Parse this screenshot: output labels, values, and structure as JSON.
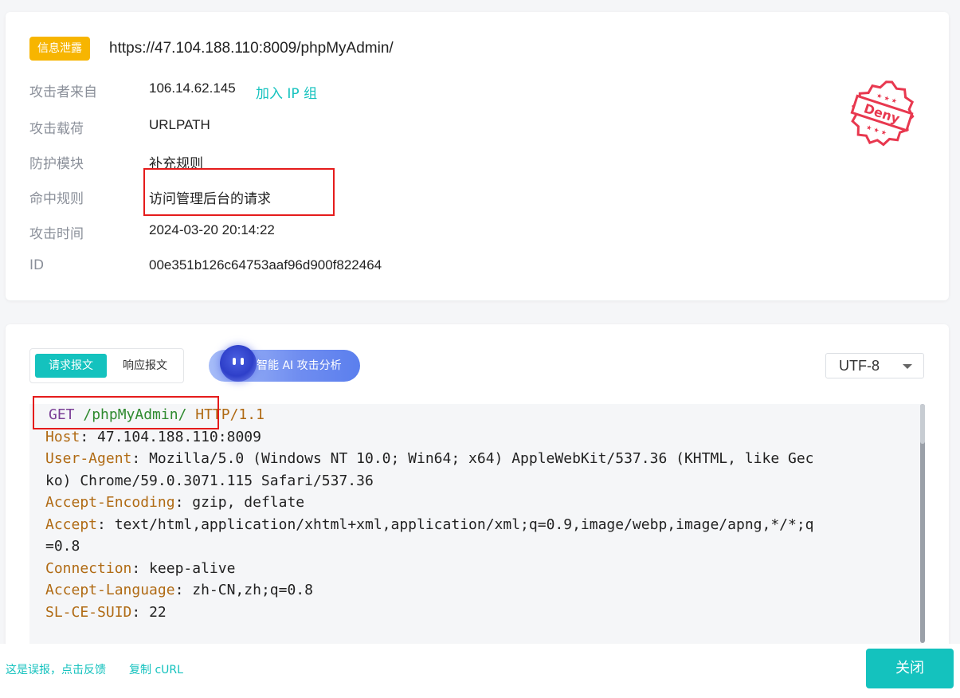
{
  "event": {
    "tag": "信息泄露",
    "url": "https://47.104.188.110:8009/phpMyAdmin/",
    "rows": [
      {
        "label": "攻击者来自",
        "value": "106.14.62.145"
      },
      {
        "label": "攻击载荷",
        "value": "URLPATH"
      },
      {
        "label": "防护模块",
        "value": "补充规则"
      },
      {
        "label": "命中规则",
        "value": "访问管理后台的请求"
      },
      {
        "label": "攻击时间",
        "value": "2024-03-20 20:14:22"
      },
      {
        "label": "ID",
        "value": "00e351b126c64753aaf96d900f822464"
      }
    ],
    "add_ip_group": "加入 IP 组",
    "stamp_text": "Deny"
  },
  "request": {
    "tabs": [
      "请求报文",
      "响应报文"
    ],
    "ai_button": "智能 AI 攻击分析",
    "encoding": "UTF-8",
    "request_line": {
      "method": "GET",
      "path": "/phpMyAdmin/",
      "protocol": "HTTP/1.1"
    },
    "headers": [
      {
        "name": "Host",
        "value": "47.104.188.110:8009"
      },
      {
        "name": "User-Agent",
        "value": "Mozilla/5.0 (Windows NT 10.0; Win64; x64) AppleWebKit/537.36 (KHTML, like Gec",
        "cont": "ko) Chrome/59.0.3071.115 Safari/537.36"
      },
      {
        "name": "Accept-Encoding",
        "value": "gzip, deflate"
      },
      {
        "name": "Accept",
        "value": "text/html,application/xhtml+xml,application/xml;q=0.9,image/webp,image/apng,*/*;q",
        "cont": "=0.8"
      },
      {
        "name": "Connection",
        "value": "keep-alive"
      },
      {
        "name": "Accept-Language",
        "value": "zh-CN,zh;q=0.8"
      },
      {
        "name": "SL-CE-SUID",
        "value": "22"
      }
    ]
  },
  "footer": {
    "false_positive": "这是误报，点击反馈",
    "copy_curl": "复制 cURL",
    "close": "关闭"
  },
  "colors": {
    "accent": "#14c2be",
    "tag": "#f7b500",
    "highlight_box": "#e51b1b",
    "stamp": "#e8384f"
  }
}
